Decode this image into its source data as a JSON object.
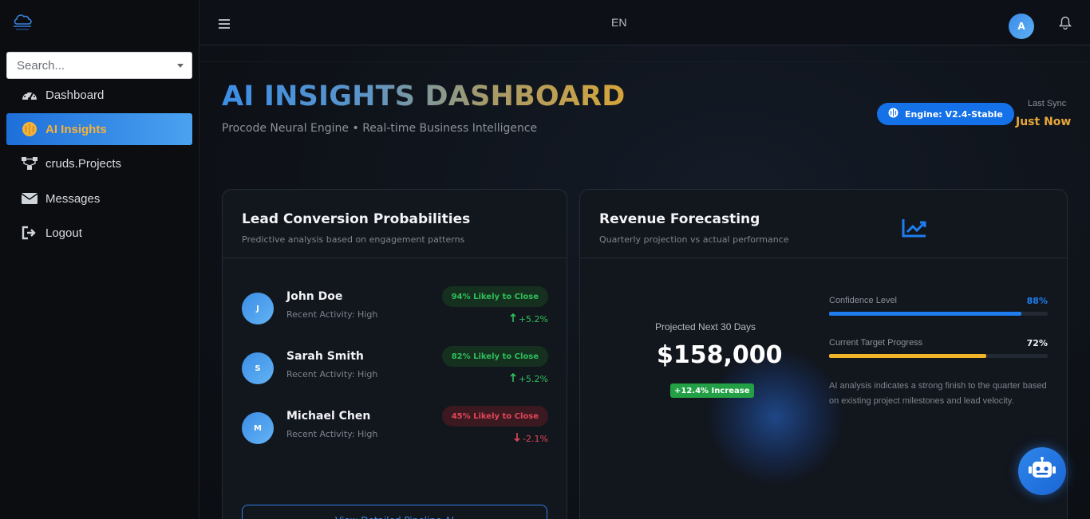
{
  "sidebar": {
    "search_placeholder": "Search...",
    "items": [
      {
        "label": "Dashboard",
        "icon": "gauge-icon"
      },
      {
        "label": "AI Insights",
        "icon": "brain-icon",
        "active": true
      },
      {
        "label": "cruds.Projects",
        "icon": "sitemap-icon"
      },
      {
        "label": "Messages",
        "icon": "envelope-icon"
      },
      {
        "label": "Logout",
        "icon": "logout-icon"
      }
    ]
  },
  "topbar": {
    "language": "EN",
    "avatar_initial": "A"
  },
  "header": {
    "title": "AI INSIGHTS DASHBOARD",
    "subtitle": "Procode Neural Engine • Real-time Business Intelligence",
    "engine_badge": "Engine: V2.4-Stable",
    "sync_label": "Last Sync",
    "sync_value": "Just Now"
  },
  "lead_card": {
    "title": "Lead Conversion Probabilities",
    "subtitle": "Predictive analysis based on engagement patterns",
    "leads": [
      {
        "initial": "J",
        "name": "John Doe",
        "activity": "Recent Activity: High",
        "probability": "94% Likely to Close",
        "delta": "+5.2%",
        "trend": "up"
      },
      {
        "initial": "S",
        "name": "Sarah Smith",
        "activity": "Recent Activity: High",
        "probability": "82% Likely to Close",
        "delta": "+5.2%",
        "trend": "up"
      },
      {
        "initial": "M",
        "name": "Michael Chen",
        "activity": "Recent Activity: High",
        "probability": "45% Likely to Close",
        "delta": "-2.1%",
        "trend": "down"
      }
    ],
    "button_label": "View Detailed Pipeline AI"
  },
  "revenue_card": {
    "title": "Revenue Forecasting",
    "subtitle": "Quarterly projection vs actual performance",
    "projected_label": "Projected Next 30 Days",
    "projected_value": "$158,000",
    "increase_badge": "+12.4% Increase",
    "confidence_label": "Confidence Level",
    "confidence_value": "88%",
    "confidence_fraction": 0.88,
    "target_label": "Current Target Progress",
    "target_value": "72%",
    "target_fraction": 0.72,
    "note": "AI analysis indicates a strong finish to the quarter based on existing project milestones and lead velocity."
  },
  "colors": {
    "accent_blue": "#1471e8",
    "accent_gold": "#e8a73a",
    "success": "#2fbf5b",
    "danger": "#e2465a",
    "confidence_bar": "#1e7ef0",
    "target_bar": "#f0b429"
  }
}
